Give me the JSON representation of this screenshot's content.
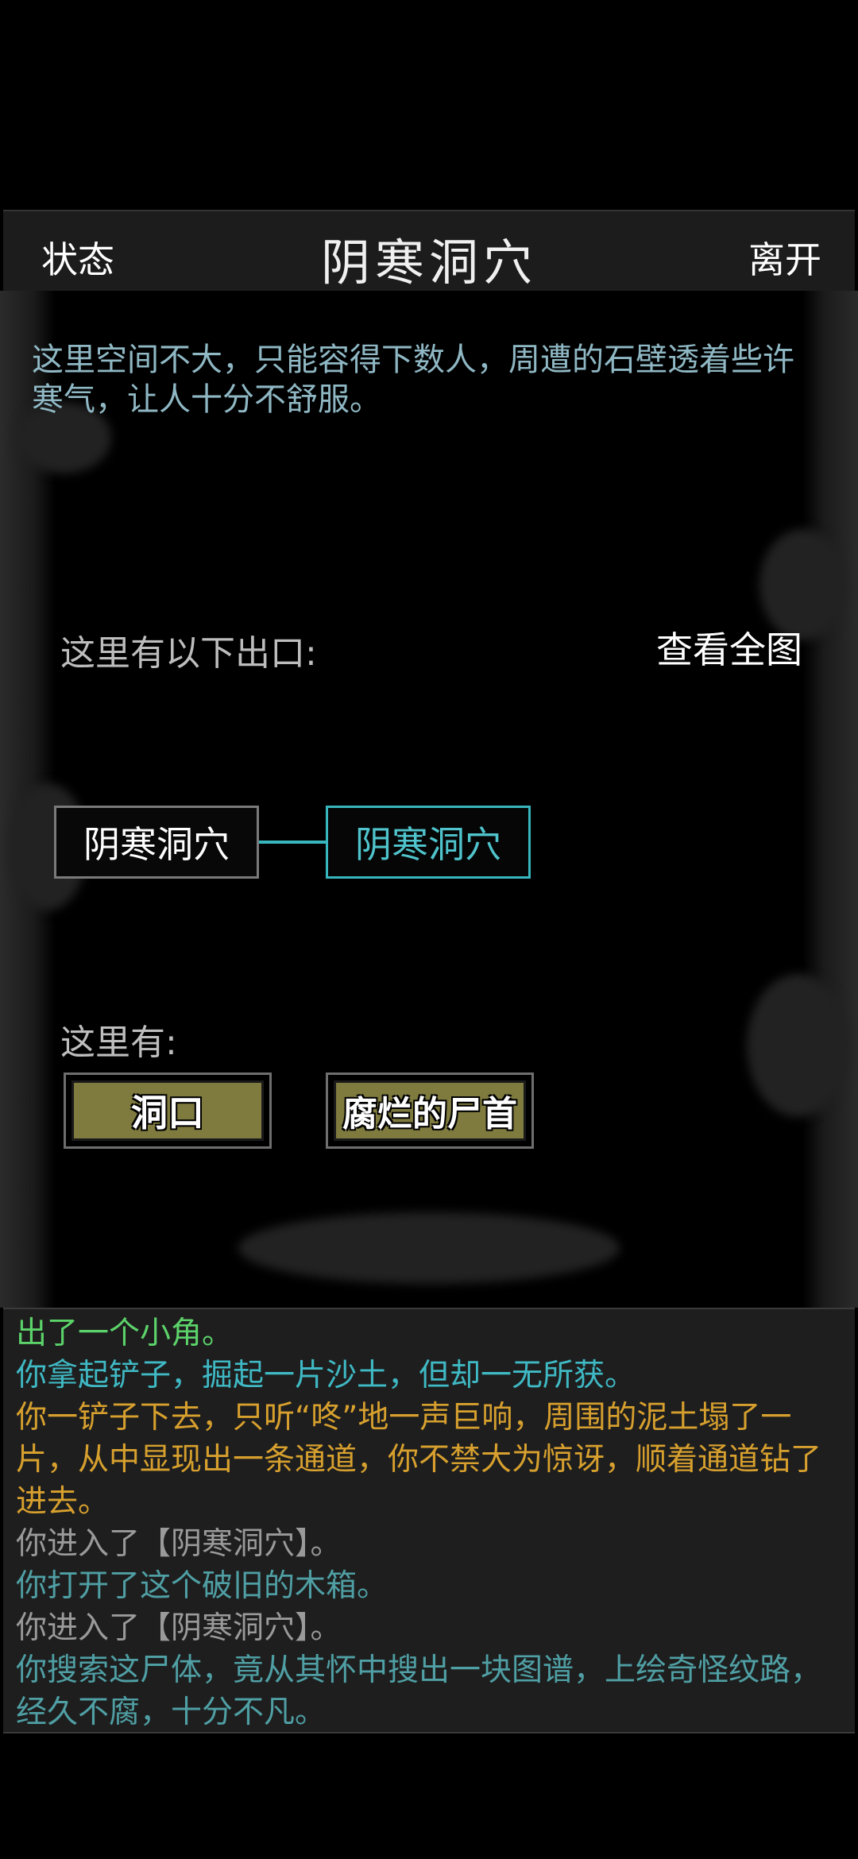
{
  "header": {
    "status_label": "状态",
    "title": "阴寒洞穴",
    "leave_label": "离开"
  },
  "scene": {
    "description": "这里空间不大，只能容得下数人，周遭的石壁透着些许寒气，让人十分不舒服。",
    "exits_label": "这里有以下出口:",
    "view_map_label": "查看全图",
    "exits": [
      {
        "label": "阴寒洞穴",
        "current": false
      },
      {
        "label": "阴寒洞穴",
        "current": true
      }
    ],
    "here_label": "这里有:",
    "objects": [
      {
        "label": "洞口"
      },
      {
        "label": "腐烂的尸首"
      }
    ]
  },
  "colors": {
    "green": "#5cd36a",
    "cyan": "#3fb9c4",
    "orange": "#d7a02e",
    "gray": "#9a9a9a",
    "teal": "#4f9fa4",
    "item_fill": "#7f7a3e",
    "current_room": "#37b6bd"
  },
  "log": [
    {
      "text": "出了一个小角。",
      "color": "#5cd36a"
    },
    {
      "text": "你拿起铲子，掘起一片沙土，但却一无所获。",
      "color": "#3fb9c4"
    },
    {
      "text": "你一铲子下去，只听“咚”地一声巨响，周围的泥土塌了一片，从中显现出一条通道，你不禁大为惊讶，顺着通道钻了进去。",
      "color": "#d7a02e"
    },
    {
      "text": "你进入了【阴寒洞穴】。",
      "color": "#9a9a9a"
    },
    {
      "text": "你打开了这个破旧的木箱。",
      "color": "#4f9fa4"
    },
    {
      "text": "你进入了【阴寒洞穴】。",
      "color": "#9a9a9a"
    },
    {
      "text": "你搜索这尸体，竟从其怀中搜出一块图谱，上绘奇怪纹路，经久不腐，十分不凡。",
      "color": "#4f9fa4"
    }
  ]
}
